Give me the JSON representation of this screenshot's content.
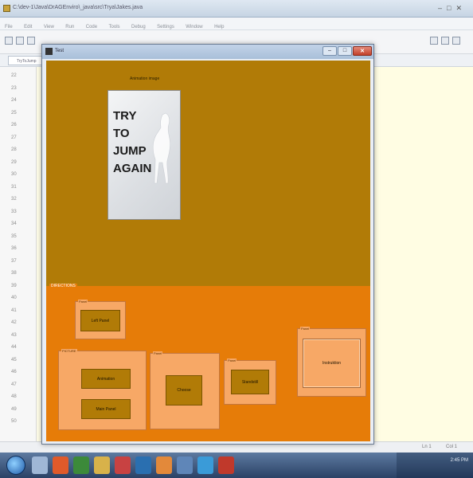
{
  "ide": {
    "title": "C:\\dev-1\\Java\\DrAGEnviro\\_java\\src\\Trya\\Jakes.java",
    "menus": [
      "File",
      "Edit",
      "View",
      "Run",
      "Code",
      "Tools",
      "Debug",
      "Settings",
      "Window",
      "Help"
    ],
    "tab_label": "TryToJump",
    "line_numbers": [
      "22",
      "23",
      "24",
      "25",
      "26",
      "27",
      "28",
      "29",
      "30",
      "31",
      "32",
      "33",
      "34",
      "35",
      "36",
      "37",
      "38",
      "39",
      "40",
      "41",
      "42",
      "43",
      "44",
      "45",
      "46",
      "47",
      "48",
      "49",
      "50"
    ],
    "status_left": "Ln 1",
    "status_right": "Col 1",
    "clock": "2:45 PM"
  },
  "frame": {
    "title": "Test",
    "image_caption": "Animation image",
    "poster_lines": [
      "TRY",
      "TO",
      "JUMP",
      "AGAIN"
    ],
    "bottom_title": "DIRECTIONS",
    "groups": {
      "g1": {
        "title": "Panel",
        "button": "Left Panel"
      },
      "g2": {
        "title": "PICTURE",
        "buttons": [
          "Animation",
          "Main Panel"
        ]
      },
      "g3": {
        "title": "Panel",
        "button": "Choose"
      },
      "g4": {
        "title": "Panel",
        "button": "Standstill"
      },
      "g5": {
        "title": "Panel",
        "button": "Instruktion"
      }
    }
  },
  "colors": {
    "top_panel": "#b17b07",
    "bottom_panel": "#e67c08",
    "group_box": "#f7a866"
  }
}
